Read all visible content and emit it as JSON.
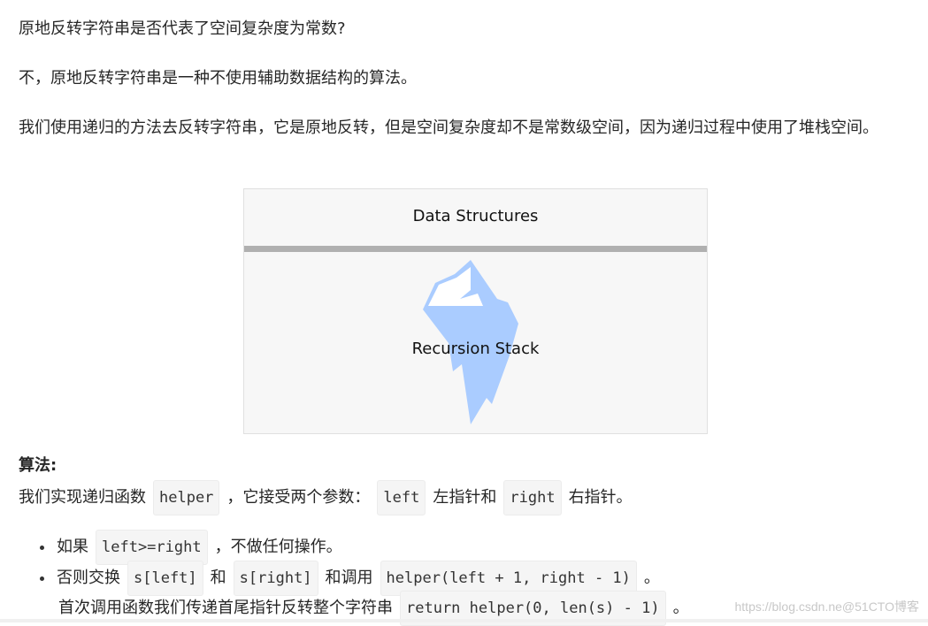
{
  "paragraphs": {
    "question": "原地反转字符串是否代表了空间复杂度为常数?",
    "answer": "不，原地反转字符串是一种不使用辅助数据结构的算法。",
    "explanation": "我们使用递归的方法去反转字符串，它是原地反转，但是空间复杂度却不是常数级空间，因为递归过程中使用了堆栈空间。"
  },
  "figure": {
    "title": "Data Structures",
    "label": "Recursion Stack",
    "colors": {
      "iceberg": "#aaccff",
      "snow": "#ffffff",
      "divider": "#b0b0b0",
      "background": "#f7f7f7"
    }
  },
  "algorithm": {
    "heading": "算法:",
    "intro": {
      "t1": "我们实现递归函数",
      "c1": "helper",
      "t2": "，它接受两个参数：",
      "c2": "left",
      "t3": "左指针和",
      "c3": "right",
      "t4": "右指针。"
    },
    "bullets": [
      {
        "t1": "如果",
        "c1": "left>=right",
        "t2": "，不做任何操作。"
      },
      {
        "t1": "否则交换",
        "c1": "s[left]",
        "t2": "和",
        "c2": "s[right]",
        "t3": "和调用",
        "c3": "helper(left + 1, right - 1)",
        "t4": "。"
      }
    ],
    "continuation": {
      "t1": "首次调用函数我们传递首尾指针反转整个字符串",
      "c1": "return helper(0, len(s) - 1)",
      "t2": "。"
    }
  },
  "watermark": "https://blog.csdn.ne@51CTO博客"
}
